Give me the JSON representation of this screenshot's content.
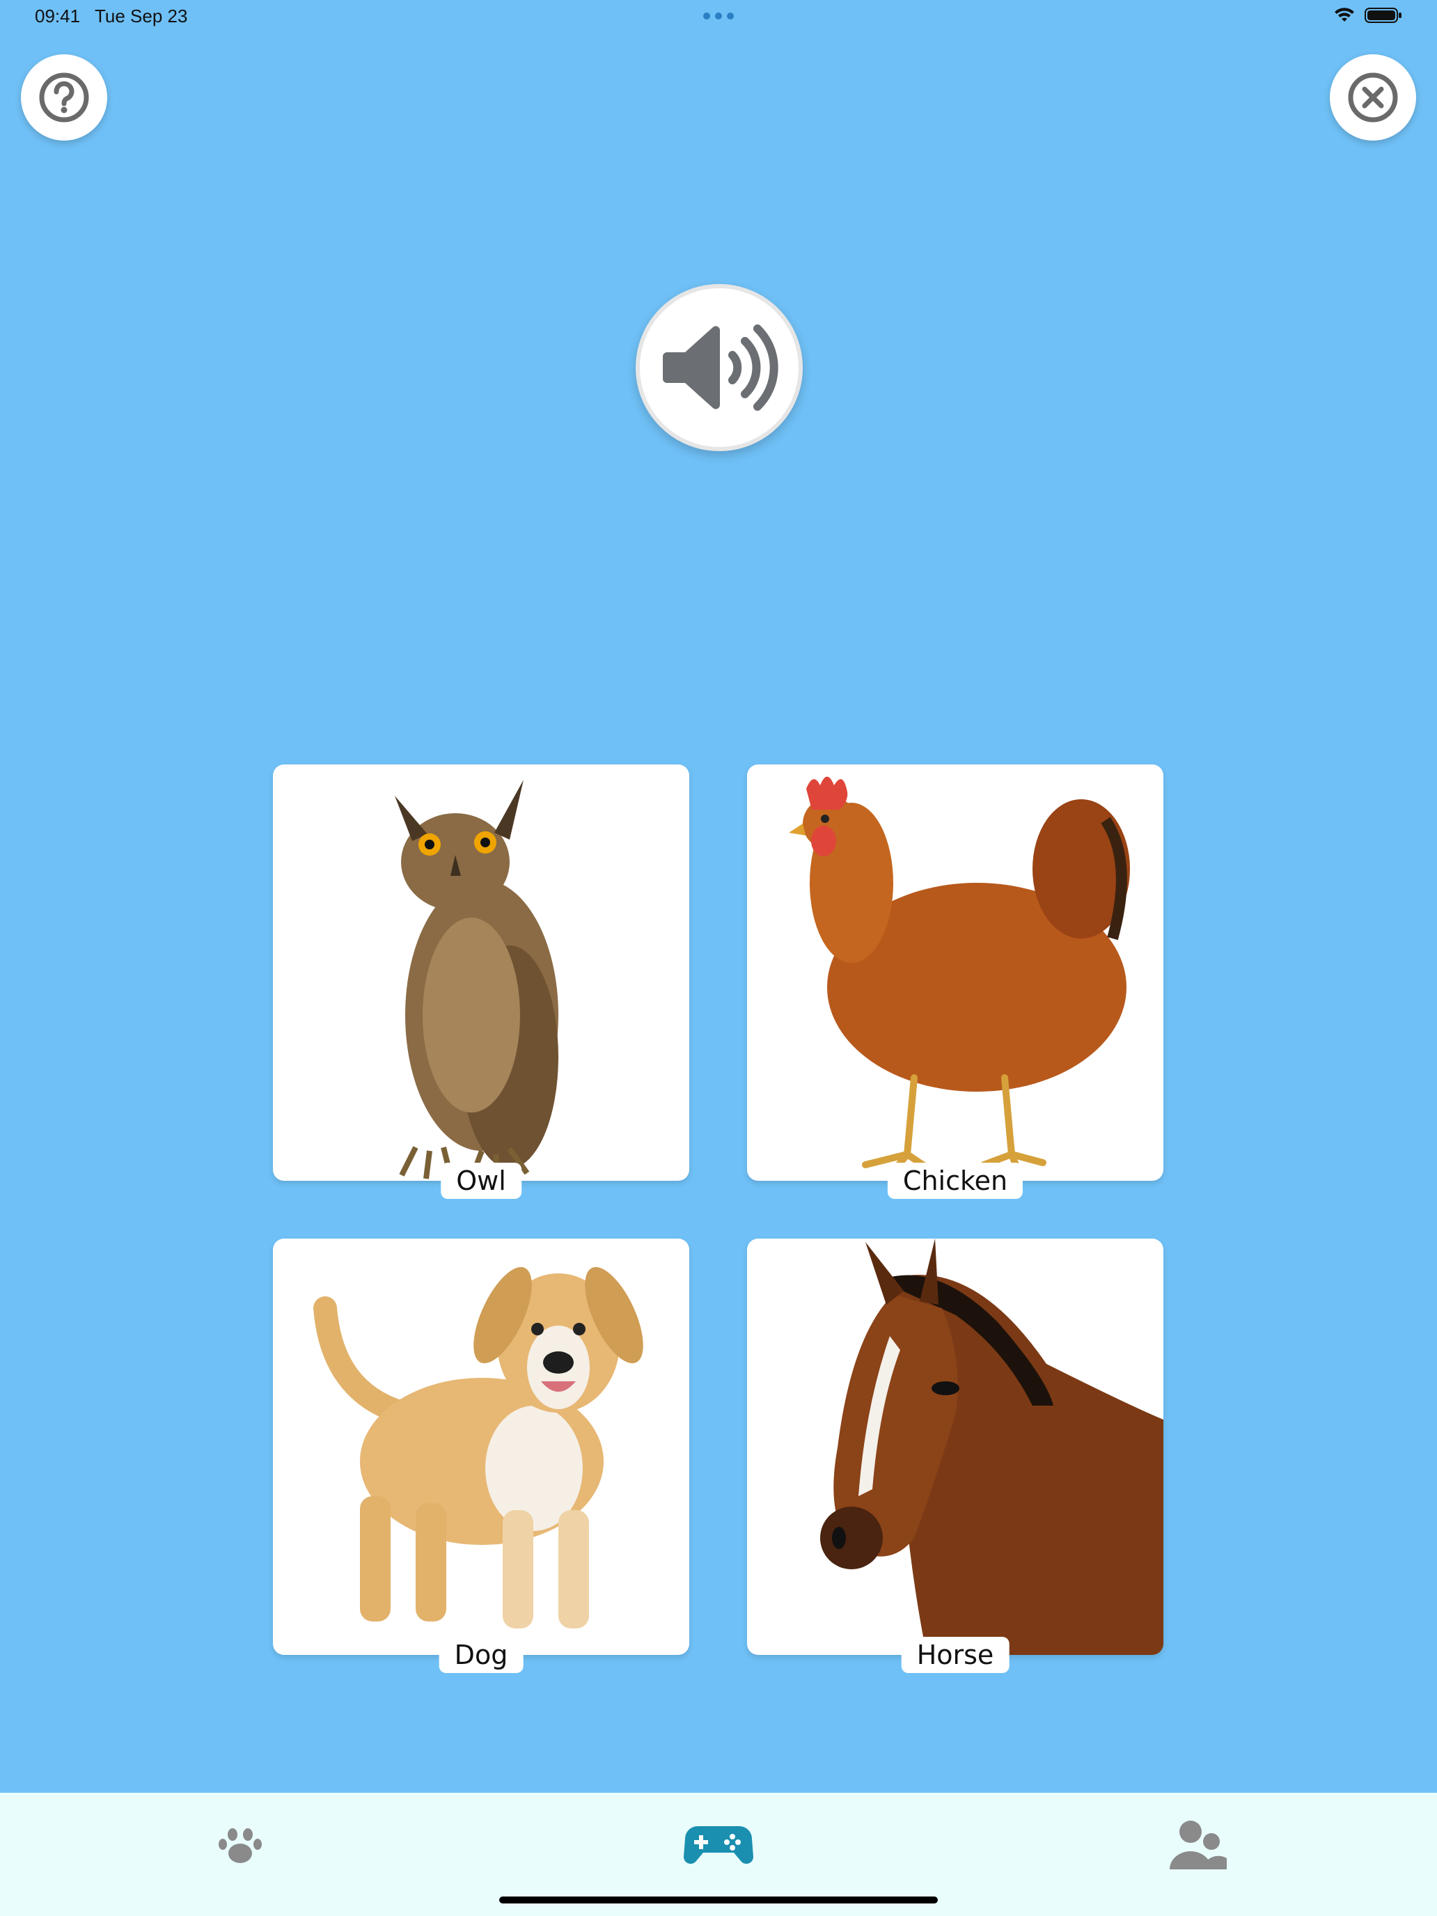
{
  "status": {
    "time": "09:41",
    "date": "Tue Sep 23"
  },
  "header": {
    "help_icon": "question-circle-icon",
    "close_icon": "close-circle-icon"
  },
  "prompt": {
    "sound_icon": "speaker-volume-icon"
  },
  "answers": [
    {
      "label": "Owl",
      "image": "owl"
    },
    {
      "label": "Chicken",
      "image": "chicken"
    },
    {
      "label": "Dog",
      "image": "dog"
    },
    {
      "label": "Horse",
      "image": "horse"
    }
  ],
  "tab_bar": {
    "items": [
      {
        "icon": "paw-icon",
        "active": false
      },
      {
        "icon": "gamepad-icon",
        "active": true
      },
      {
        "icon": "users-icon",
        "active": false
      }
    ]
  },
  "colors": {
    "background": "#6fc0f6",
    "tab_bar": "#e9fdfd",
    "active_tab": "#1a8fb0",
    "inactive_tab": "#8a8a8a"
  }
}
